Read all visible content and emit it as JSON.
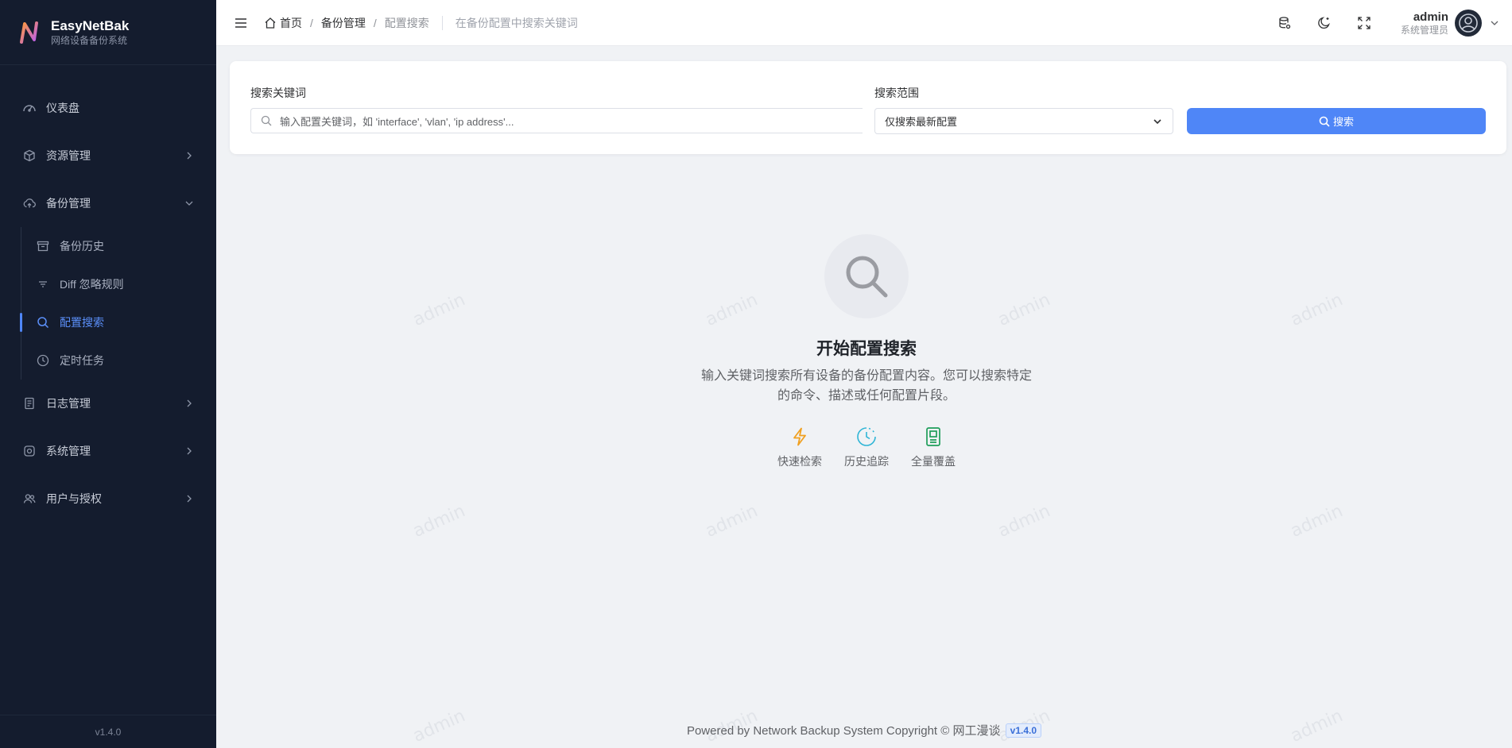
{
  "brand": {
    "name": "EasyNetBak",
    "subtitle": "网络设备备份系统"
  },
  "sidebar": {
    "items": [
      {
        "label": "仪表盘",
        "icon": "dashboard-icon"
      },
      {
        "label": "资源管理",
        "icon": "cube-icon",
        "expandable": true
      },
      {
        "label": "备份管理",
        "icon": "cloud-upload-icon",
        "expanded": true,
        "children": [
          {
            "label": "备份历史",
            "icon": "archive-icon"
          },
          {
            "label": "Diff 忽略规则",
            "icon": "filter-icon"
          },
          {
            "label": "配置搜索",
            "icon": "search-icon",
            "active": true
          },
          {
            "label": "定时任务",
            "icon": "clock-icon"
          }
        ]
      },
      {
        "label": "日志管理",
        "icon": "document-icon",
        "expandable": true
      },
      {
        "label": "系统管理",
        "icon": "settings-icon",
        "expandable": true
      },
      {
        "label": "用户与授权",
        "icon": "users-icon",
        "expandable": true
      }
    ],
    "version": "v1.4.0"
  },
  "header": {
    "breadcrumb": {
      "home": "首页",
      "section": "备份管理",
      "current": "配置搜索"
    },
    "description": "在备份配置中搜索关键词",
    "user": {
      "name": "admin",
      "role": "系统管理员"
    }
  },
  "search": {
    "keyword_label": "搜索关键词",
    "keyword_placeholder": "输入配置关键词，如 'interface', 'vlan', 'ip address'...",
    "keyword_value": "",
    "scope_label": "搜索范围",
    "scope_value": "仅搜索最新配置",
    "button_label": "搜索"
  },
  "empty_state": {
    "title": "开始配置搜索",
    "description": "输入关键词搜索所有设备的备份配置内容。您可以搜索特定的命令、描述或任何配置片段。",
    "features": [
      {
        "label": "快速检索",
        "icon": "lightning-icon",
        "color": "#f0a020"
      },
      {
        "label": "历史追踪",
        "icon": "clock-icon",
        "color": "#2fb5d6"
      },
      {
        "label": "全量覆盖",
        "icon": "sd-card-icon",
        "color": "#1e9e5a"
      }
    ]
  },
  "footer": {
    "text": "Powered by Network Backup System Copyright © 网工漫谈",
    "version": "v1.4.0"
  },
  "watermark": "admin",
  "colors": {
    "sidebar_bg": "#141c2e",
    "accent": "#4f86f7",
    "page_bg": "#f0f2f5"
  }
}
